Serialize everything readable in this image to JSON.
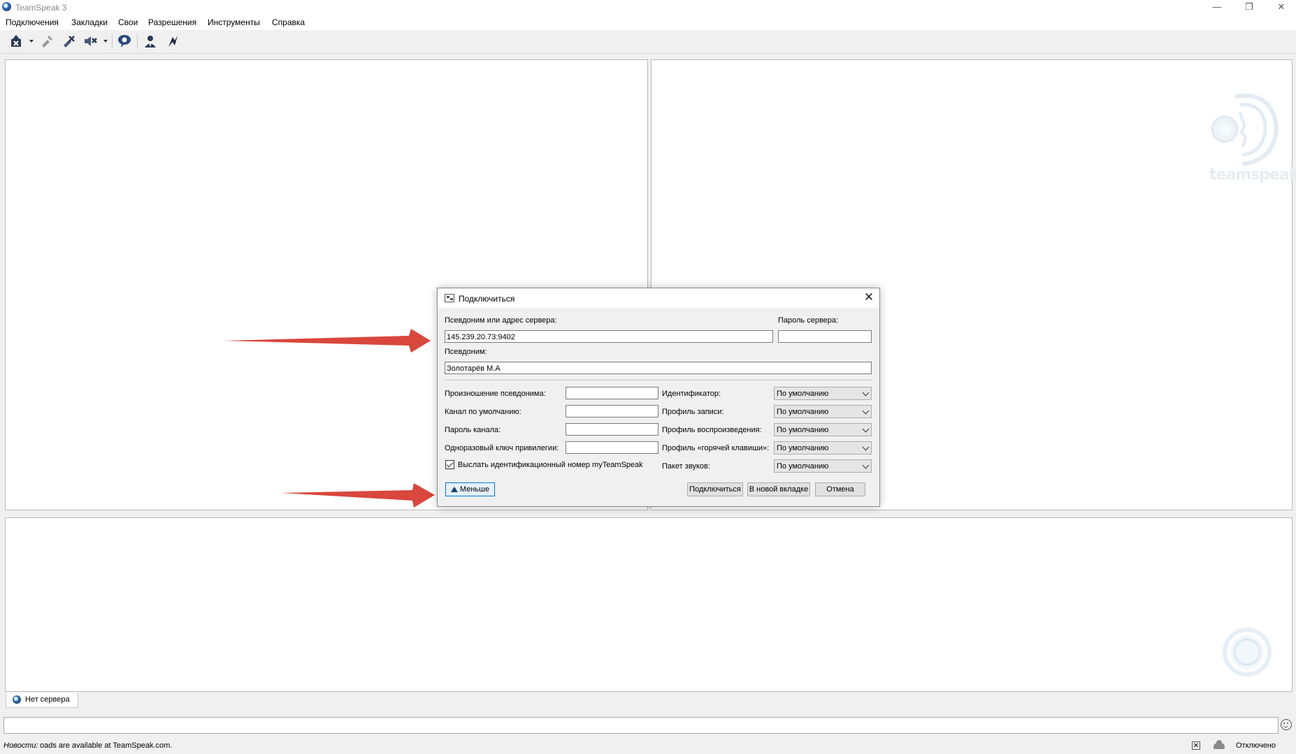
{
  "window": {
    "title": "TeamSpeak 3",
    "controls": {
      "minimize": "—",
      "restore": "❐",
      "close": "✕"
    }
  },
  "menu": [
    "Подключения",
    "Закладки",
    "Свои",
    "Разрешения",
    "Инструменты",
    "Справка"
  ],
  "toolbar": {
    "icons": [
      "connect-icon",
      "disconnect-icon",
      "mute-microphone-icon",
      "mute-speakers-icon",
      "away-icon",
      "contacts-icon",
      "subscribe-icon"
    ]
  },
  "watermark": {
    "brand": "teamspeak"
  },
  "server_tab": {
    "label": "Нет сервера"
  },
  "status": {
    "news_label": "Новости:",
    "news_text": "oads are available at TeamSpeak.com.",
    "connection": "Отключено"
  },
  "dialog": {
    "title": "Подключиться",
    "address_label": "Псевдоним или адрес сервера:",
    "address_value": "145.239.20.73:9402",
    "password_label": "Пароль сервера:",
    "password_value": "",
    "nickname_label": "Псевдоним:",
    "nickname_value": "Золотарёв М.А",
    "left_fields": [
      {
        "label": "Произношение псевдонима:",
        "value": ""
      },
      {
        "label": "Канал по умолчанию:",
        "value": ""
      },
      {
        "label": "Пароль канала:",
        "value": ""
      },
      {
        "label": "Одноразовый ключ привилегии:",
        "value": ""
      }
    ],
    "right_fields": [
      {
        "label": "Идентификатор:",
        "value": "По умолчанию"
      },
      {
        "label": "Профиль записи:",
        "value": "По умолчанию"
      },
      {
        "label": "Профиль воспроизведения:",
        "value": "По умолчанию"
      },
      {
        "label": "Профиль «горячей клавиши»:",
        "value": "По умолчанию"
      },
      {
        "label": "Пакет звуков:",
        "value": "По умолчанию"
      }
    ],
    "send_id_label": "Выслать идентификационный номер myTeamSpeak",
    "send_id_checked": true,
    "less_button": "Меньше",
    "connect_button": "Подключиться",
    "new_tab_button": "В новой вкладке",
    "cancel_button": "Отмена"
  },
  "colors": {
    "arrow": "#d9473d",
    "accent": "#0078d7"
  }
}
